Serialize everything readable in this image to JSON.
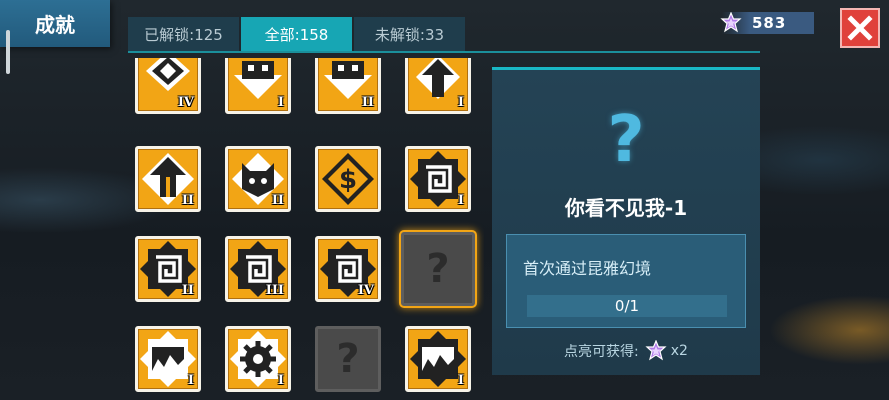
{
  "header": {
    "title": "成就"
  },
  "tabs": [
    {
      "label": "已解锁:125",
      "active": false
    },
    {
      "label": "全部:158",
      "active": true
    },
    {
      "label": "未解锁:33",
      "active": false
    }
  ],
  "currency": {
    "icon": "purple-star-icon",
    "amount": "583"
  },
  "close": {
    "icon": "close-icon"
  },
  "grid": {
    "cells": [
      {
        "icon": "triangles-badge-icon",
        "tier": "IV",
        "state": "unlocked"
      },
      {
        "icon": "robot-face-badge-icon",
        "tier": "I",
        "state": "unlocked"
      },
      {
        "icon": "robot-face-badge-icon",
        "tier": "II",
        "state": "unlocked"
      },
      {
        "icon": "hooded-figure-badge-icon",
        "tier": "I",
        "state": "unlocked"
      },
      {
        "icon": "hooded-figure-badge-icon",
        "tier": "II",
        "state": "unlocked"
      },
      {
        "icon": "cat-face-badge-icon",
        "tier": "II",
        "state": "unlocked"
      },
      {
        "icon": "dollar-badge-icon",
        "tier": "",
        "state": "unlocked"
      },
      {
        "icon": "spiral-badge-icon",
        "tier": "I",
        "state": "unlocked"
      },
      {
        "icon": "spiral-badge-icon",
        "tier": "II",
        "state": "unlocked"
      },
      {
        "icon": "spiral-badge-icon",
        "tier": "III",
        "state": "unlocked"
      },
      {
        "icon": "spiral-badge-icon",
        "tier": "IV",
        "state": "unlocked"
      },
      {
        "icon": "question-mark-icon",
        "tier": "",
        "state": "locked",
        "text": "?"
      },
      {
        "icon": "landscape-badge-icon",
        "tier": "I",
        "state": "unlocked"
      },
      {
        "icon": "gear-badge-icon",
        "tier": "I",
        "state": "unlocked"
      },
      {
        "icon": "question-mark-icon",
        "tier": "",
        "state": "locked",
        "text": "?"
      },
      {
        "icon": "landscape-badge-icon",
        "tier": "I",
        "state": "unlocked"
      }
    ]
  },
  "detail": {
    "icon": "question-mark-icon",
    "icon_text": "?",
    "name": "你看不见我-1",
    "description": "首次通过昆雅幻境",
    "progress": "0/1",
    "reward_label": "点亮可获得:",
    "reward_icon": "purple-star-icon",
    "reward_amount": "x2"
  },
  "colors": {
    "accent": "#17a6b4",
    "badge": "#f2a515",
    "close": "#e0413b",
    "question": "#4fb9e0"
  }
}
